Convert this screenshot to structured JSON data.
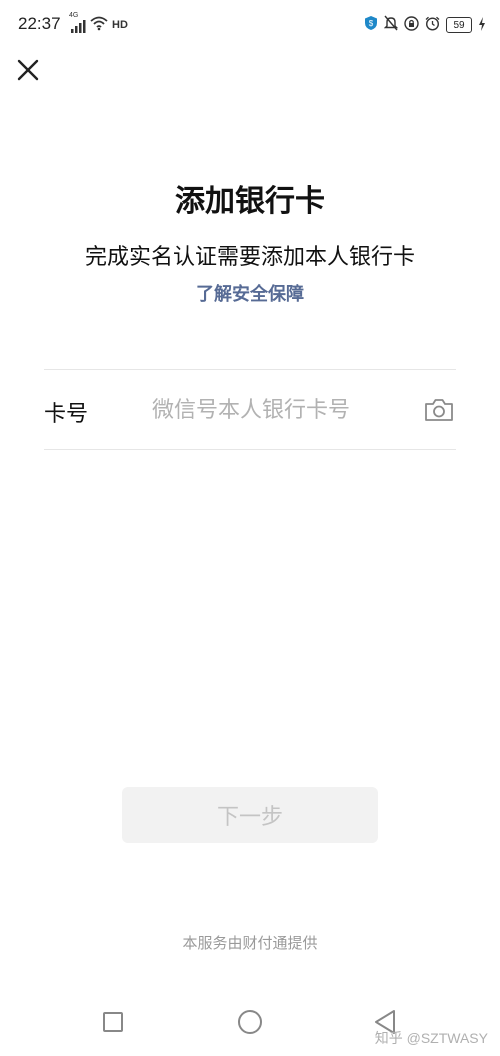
{
  "status_bar": {
    "time": "22:37",
    "network": "4G",
    "hd": "HD",
    "battery": "59",
    "icons": [
      "signal-icon",
      "wifi-icon",
      "vpn-shield-icon",
      "mute-icon",
      "lock-rotation-icon",
      "alarm-icon",
      "battery-icon",
      "charging-icon"
    ]
  },
  "header": {
    "close_icon": "close-icon"
  },
  "main": {
    "title": "添加银行卡",
    "subtitle": "完成实名认证需要添加本人银行卡",
    "security_link": "了解安全保障",
    "card_field": {
      "label": "卡号",
      "value": "",
      "placeholder": "微信号本人银行卡号",
      "camera_icon": "camera-icon"
    },
    "next_button": "下一步",
    "provider_note": "本服务由财付通提供"
  },
  "nav_bar": {
    "icons": [
      "recent-apps-icon",
      "home-icon",
      "back-icon"
    ]
  },
  "watermark": "知乎 @SZTWASY",
  "colors": {
    "link": "#576b95",
    "button_bg": "#f2f2f2",
    "button_text": "#c4c4c4",
    "placeholder": "#b2b2b2"
  }
}
